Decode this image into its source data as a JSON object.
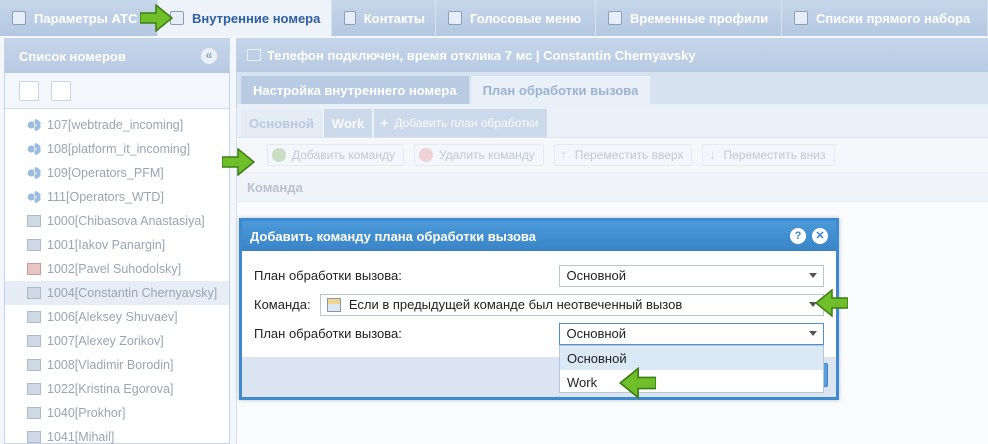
{
  "top_tabs": [
    {
      "label": "Параметры АТС",
      "icon": "settings-icon"
    },
    {
      "label": "Внутренние номера",
      "icon": "phonebook-icon"
    },
    {
      "label": "Контакты",
      "icon": "contacts-icon"
    },
    {
      "label": "Голосовые меню",
      "icon": "speaker-icon"
    },
    {
      "label": "Временные профили",
      "icon": "clock-icon"
    },
    {
      "label": "Списки прямого набора",
      "icon": "list-icon"
    }
  ],
  "sidebar": {
    "title": "Список номеров",
    "collapse_icon": "«",
    "items": [
      {
        "label": "107[webtrade_incoming]",
        "icon": "share-icon"
      },
      {
        "label": "108[platform_it_incoming]",
        "icon": "share-icon"
      },
      {
        "label": "109[Operators_PFM]",
        "icon": "share-icon"
      },
      {
        "label": "111[Operators_WTD]",
        "icon": "share-icon"
      },
      {
        "label": "1000[Chibasova Anastasiya]",
        "icon": "phone-icon"
      },
      {
        "label": "1001[Iakov Panargin]",
        "icon": "phone-icon"
      },
      {
        "label": "1002[Pavel Suhodolsky]",
        "icon": "phone-red-icon"
      },
      {
        "label": "1004[Constantin Chernyavsky]",
        "icon": "phone-icon"
      },
      {
        "label": "1006[Aleksey Shuvaev]",
        "icon": "phone-icon"
      },
      {
        "label": "1007[Alexey Zorikov]",
        "icon": "phone-icon"
      },
      {
        "label": "1008[Vladimir Borodin]",
        "icon": "phone-icon"
      },
      {
        "label": "1022[Kristina Egorova]",
        "icon": "phone-icon"
      },
      {
        "label": "1040[Prokhor]",
        "icon": "phone-icon"
      },
      {
        "label": "1041[Mihail]",
        "icon": "phone-icon"
      }
    ]
  },
  "main": {
    "title": "Телефон подключен, время отклика 7 мс | Constantin Chernyavsky",
    "subtabs": [
      "Настройка внутреннего номера",
      "План обработки вызова"
    ],
    "plan_tabs": [
      "Основной",
      "Work"
    ],
    "add_plan_label": "Добавить план обработки",
    "commands": {
      "add": "Добавить команду",
      "delete": "Удалить команду",
      "up": "Переместить вверх",
      "down": "Переместить вниз"
    },
    "grid_header": "Команда"
  },
  "dialog": {
    "title": "Добавить команду плана обработки вызова",
    "field1_label": "План обработки вызова:",
    "field1_value": "Основной",
    "command_label": "Команда:",
    "command_value": "Если в предыдущей команде был неотвеченный вызов",
    "field2_label": "План обработки вызова:",
    "field2_value": "Основной",
    "dropdown_options": [
      "Основной",
      "Work"
    ]
  },
  "colors": {
    "accent": "#3d8ad0",
    "header": "#b7cae2",
    "arrow": "#6fbf2a"
  }
}
